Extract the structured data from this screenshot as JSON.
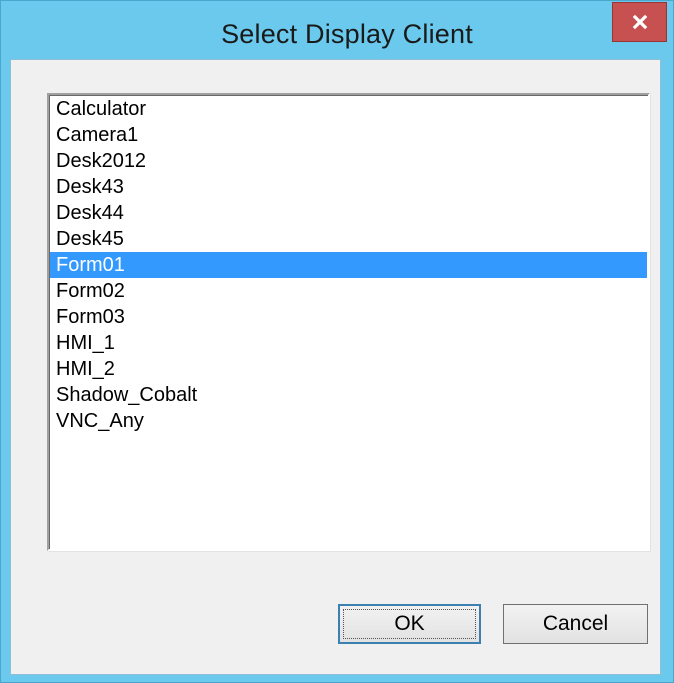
{
  "window": {
    "title": "Select Display Client",
    "close_label": "x"
  },
  "clients": [
    {
      "label": "Calculator",
      "selected": false
    },
    {
      "label": "Camera1",
      "selected": false
    },
    {
      "label": "Desk2012",
      "selected": false
    },
    {
      "label": "Desk43",
      "selected": false
    },
    {
      "label": "Desk44",
      "selected": false
    },
    {
      "label": "Desk45",
      "selected": false
    },
    {
      "label": "Form01",
      "selected": true
    },
    {
      "label": "Form02",
      "selected": false
    },
    {
      "label": "Form03",
      "selected": false
    },
    {
      "label": "HMI_1",
      "selected": false
    },
    {
      "label": "HMI_2",
      "selected": false
    },
    {
      "label": "Shadow_Cobalt",
      "selected": false
    },
    {
      "label": "VNC_Any",
      "selected": false
    }
  ],
  "buttons": {
    "ok_label": "OK",
    "cancel_label": "Cancel"
  },
  "colors": {
    "titlebar": "#6ac9ec",
    "close_button": "#c75050",
    "selection": "#3399ff"
  }
}
